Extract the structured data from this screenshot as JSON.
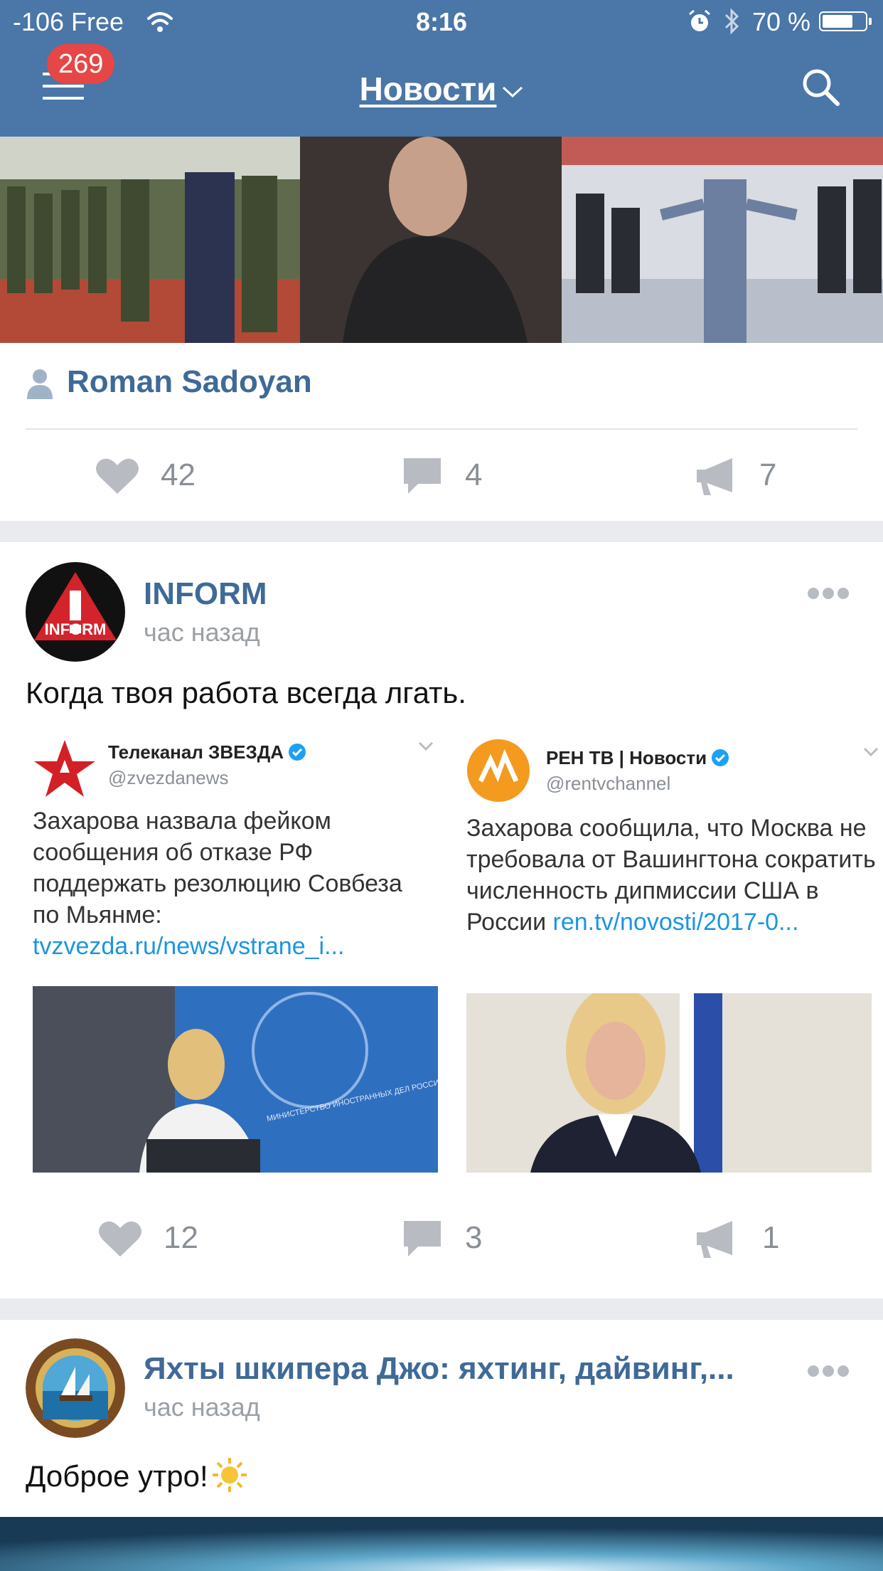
{
  "status_bar": {
    "carrier": "-106 Free",
    "time": "8:16",
    "battery_percent": "70 %",
    "battery_level": 0.7,
    "icons": [
      "wifi-icon",
      "alarm-icon",
      "bluetooth-icon",
      "battery-icon"
    ]
  },
  "header": {
    "menu_badge": "269",
    "title": "Новости",
    "icons": [
      "menu-icon",
      "chevron-down-icon",
      "search-icon"
    ]
  },
  "colors": {
    "header_bg": "#4a76a8",
    "author_link": "#3f6a97",
    "badge": "#e64646",
    "tweet_link": "#1b95e0"
  },
  "posts": [
    {
      "author": "Roman Sadoyan",
      "likes": "42",
      "comments": "4",
      "reposts": "7"
    },
    {
      "author": "INFORM",
      "avatar_text": "INFORM",
      "time": "час назад",
      "text": "Когда твоя работа всегда лгать.",
      "tweets": [
        {
          "name": "Телеканал ЗВЕЗДА",
          "handle": "@zvezdanews",
          "body": "Захарова назвала фейком сообщения об отказе РФ поддержать резолюцию Совбеза по Мьянме:",
          "link": "tvzvezda.ru/news/vstrane_i...",
          "image_text": "МИНИСТЕРСТВО ИНОСТРАННЫХ ДЕЛ РОССИЙСКОЙ ФЕДЕРАЦИИ"
        },
        {
          "name": "РЕН ТВ | Новости",
          "handle": "@rentvchannel",
          "body": "Захарова сообщила, что Москва не требовала от Вашингтона сократить численность дипмиссии США в России",
          "link": "ren.tv/novosti/2017-0..."
        }
      ],
      "likes": "12",
      "comments": "3",
      "reposts": "1"
    },
    {
      "author": "Яхты шкипера Джо: яхтинг, дайвинг,...",
      "time": "час назад",
      "text": "Доброе утро!"
    }
  ]
}
